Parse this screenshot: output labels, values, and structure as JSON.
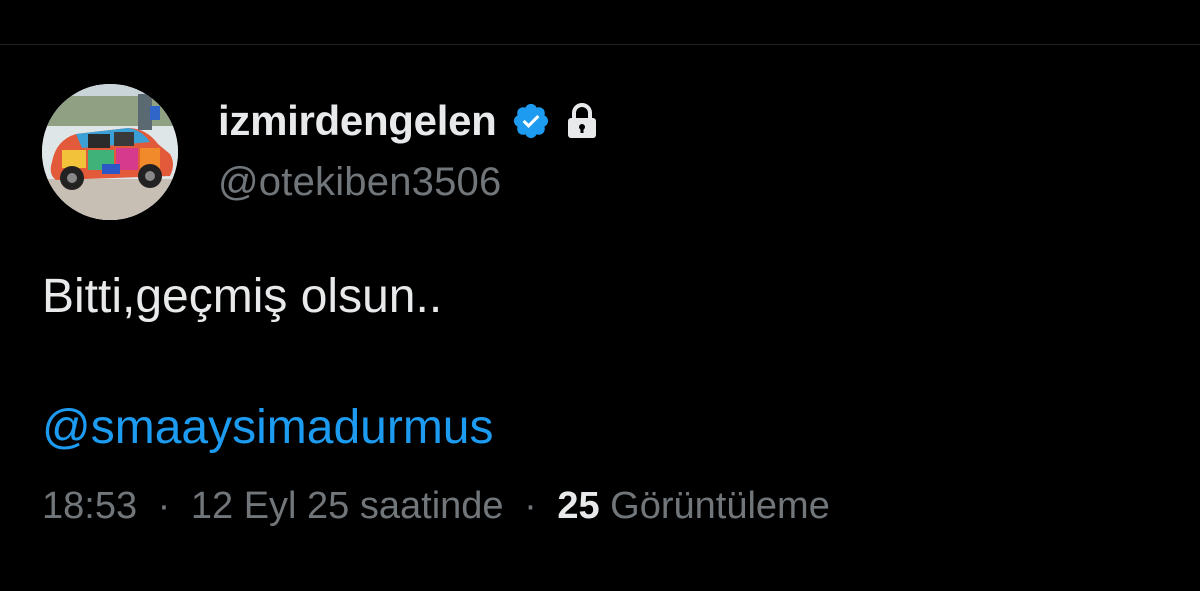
{
  "colors": {
    "background": "#000000",
    "primary_text": "#e7e9ea",
    "secondary_text": "#71767b",
    "link": "#1d9bf0",
    "verified_badge": "#1d9bf0"
  },
  "author": {
    "display_name": "izmirdengelen",
    "handle": "@otekiben3506",
    "verified": true,
    "protected": true,
    "verified_icon": "verified-badge-icon",
    "protected_icon": "lock-icon",
    "avatar": "colorful-painted-car-photo"
  },
  "tweet": {
    "text": "Bitti,geçmiş olsun..",
    "mention": "@smaaysimadurmus"
  },
  "meta": {
    "time": "18:53",
    "separator": "·",
    "date_text": "12 Eyl 25 saatinde",
    "views_count": "25",
    "views_label": "Görüntüleme"
  }
}
